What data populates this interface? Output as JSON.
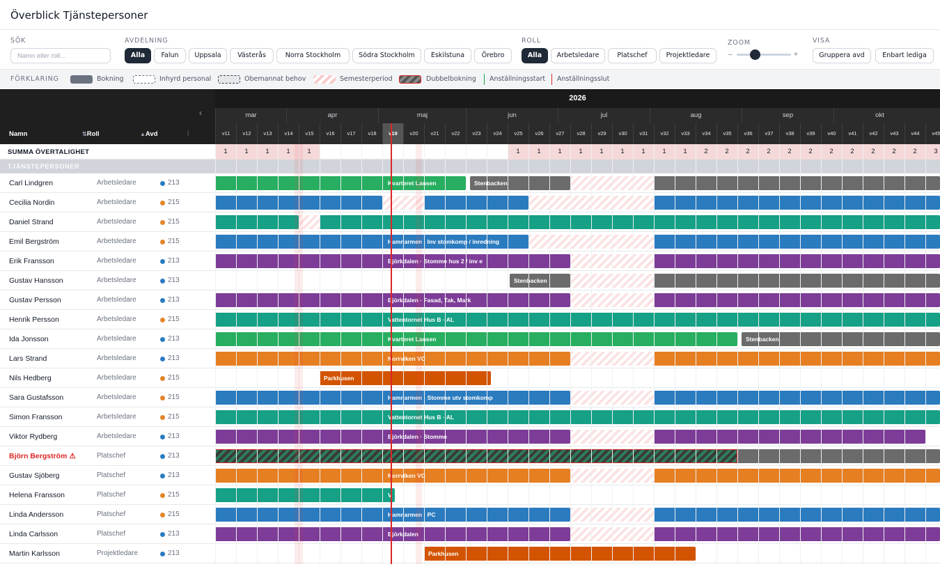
{
  "header": {
    "title": "Överblick Tjänstepersoner"
  },
  "filters": {
    "search_label": "SÖK",
    "search_placeholder": "Namn eller roll...",
    "dept_label": "AVDELNING",
    "departments": [
      "Alla",
      "Falun",
      "Uppsala",
      "Västerås",
      "Norra Stockholm",
      "Södra Stockholm",
      "Eskilstuna",
      "Örebro"
    ],
    "role_label": "ROLL",
    "roles": [
      "Alla",
      "Arbetsledare",
      "Platschef",
      "Projektledare"
    ],
    "zoom_label": "ZOOM",
    "zoom_minus": "–",
    "zoom_plus": "+",
    "view_label": "VISA",
    "views": [
      "Gruppera avd",
      "Enbart lediga"
    ]
  },
  "legend": {
    "label": "FÖRKLARING",
    "items": [
      "Bokning",
      "Inhyrd personal",
      "Obemannat behov",
      "Semesterperiod",
      "Dubbelbokning",
      "Anställningsstart",
      "Anställningsslut"
    ]
  },
  "timeline": {
    "year": "2026",
    "months": [
      "mar",
      "apr",
      "maj",
      "jun",
      "jul",
      "aug",
      "sep",
      "okt"
    ],
    "weeks": [
      "v11",
      "v12",
      "v13",
      "v14",
      "v15",
      "v16",
      "v17",
      "v18",
      "v19",
      "v20",
      "v21",
      "v22",
      "v23",
      "v24",
      "v25",
      "v26",
      "v27",
      "v28",
      "v29",
      "v30",
      "v31",
      "v32",
      "v33",
      "v34",
      "v35",
      "v36",
      "v37",
      "v38",
      "v39",
      "v40",
      "v41",
      "v42",
      "v43",
      "v44",
      "v45"
    ],
    "current_week": "v19"
  },
  "columns": {
    "name": "Namn",
    "role": "Roll",
    "dept": "Avd"
  },
  "summary": {
    "label": "SUMMA ÖVERTALIGHET",
    "values": [
      "1",
      "1",
      "1",
      "1",
      "1",
      "",
      "",
      "",
      "",
      "",
      "",
      "",
      "",
      "",
      "1",
      "1",
      "1",
      "1",
      "1",
      "1",
      "1",
      "1",
      "1",
      "2",
      "2",
      "2",
      "2",
      "2",
      "2",
      "2",
      "2",
      "2",
      "2",
      "2",
      "3"
    ]
  },
  "section": {
    "label": "TJÄNSTEPERSONER"
  },
  "colors": {
    "dept213": "#2b7bbf",
    "dept215": "#e2852b",
    "green": "#27ae60",
    "blue": "#2b7bbf",
    "teal": "#16a085",
    "purple": "#7d3c98",
    "orange": "#e67e22",
    "darkorange": "#d35400",
    "gray": "#6b6b6b"
  },
  "people": [
    {
      "name": "Carl Lindgren",
      "role": "Arbetsledare",
      "dept": "213",
      "bars": [
        {
          "s": 0,
          "e": 12,
          "c": "green",
          "t": "Kvarteret Lansen"
        },
        {
          "s": 12.2,
          "e": 17,
          "c": "gray",
          "t": "Stenbacken"
        },
        {
          "s": 21,
          "e": 35,
          "c": "gray",
          "t": ""
        }
      ],
      "vac": [
        [
          17,
          21
        ]
      ]
    },
    {
      "name": "Cecilia Nordin",
      "role": "Arbetsledare",
      "dept": "215",
      "bars": [
        {
          "s": 0,
          "e": 8,
          "c": "blue",
          "t": ""
        },
        {
          "s": 10,
          "e": 15,
          "c": "blue",
          "t": ""
        },
        {
          "s": 21,
          "e": 35,
          "c": "blue",
          "t": ""
        }
      ],
      "vac": [
        [
          8,
          10
        ],
        [
          15,
          21
        ]
      ]
    },
    {
      "name": "Daniel Strand",
      "role": "Arbetsledare",
      "dept": "215",
      "bars": [
        {
          "s": 0,
          "e": 4,
          "c": "teal",
          "t": ""
        },
        {
          "s": 5,
          "e": 35,
          "c": "teal",
          "t": ""
        }
      ],
      "vac": [
        [
          4,
          5
        ]
      ]
    },
    {
      "name": "Emil Bergström",
      "role": "Arbetsledare",
      "dept": "215",
      "bars": [
        {
          "s": 0,
          "e": 15,
          "c": "blue",
          "t": "Hamnarmen · Inv stomkomp / inredning"
        },
        {
          "s": 21,
          "e": 35,
          "c": "blue",
          "t": ""
        }
      ],
      "vac": [
        [
          15,
          21
        ]
      ]
    },
    {
      "name": "Erik Fransson",
      "role": "Arbetsledare",
      "dept": "213",
      "bars": [
        {
          "s": 0,
          "e": 17,
          "c": "purple",
          "t": "Björkdalen · Stomme hus 2 / inv e"
        },
        {
          "s": 21,
          "e": 35,
          "c": "purple",
          "t": ""
        }
      ],
      "vac": [
        [
          17,
          21
        ]
      ]
    },
    {
      "name": "Gustav Hansson",
      "role": "Arbetsledare",
      "dept": "213",
      "bars": [
        {
          "s": 14.1,
          "e": 17,
          "c": "gray",
          "t": "Stenbacken"
        },
        {
          "s": 21,
          "e": 35,
          "c": "gray",
          "t": ""
        }
      ],
      "vac": [
        [
          17,
          21
        ]
      ]
    },
    {
      "name": "Gustav Persson",
      "role": "Arbetsledare",
      "dept": "213",
      "bars": [
        {
          "s": 0,
          "e": 17,
          "c": "purple",
          "t": "Björkdalen · Fasad, Tak, Mark"
        },
        {
          "s": 21,
          "e": 35,
          "c": "purple",
          "t": ""
        }
      ],
      "vac": [
        [
          17,
          21
        ]
      ]
    },
    {
      "name": "Henrik Persson",
      "role": "Arbetsledare",
      "dept": "215",
      "bars": [
        {
          "s": 0,
          "e": 35,
          "c": "teal",
          "t": "Vattentornet Hus B · AL"
        }
      ],
      "vac": []
    },
    {
      "name": "Ida Jonsson",
      "role": "Arbetsledare",
      "dept": "213",
      "bars": [
        {
          "s": 0,
          "e": 25,
          "c": "green",
          "t": "Kvarteret Lansen"
        },
        {
          "s": 25.2,
          "e": 35,
          "c": "gray",
          "t": "Stenbacken"
        }
      ],
      "vac": []
    },
    {
      "name": "Lars Strand",
      "role": "Arbetsledare",
      "dept": "213",
      "bars": [
        {
          "s": 0,
          "e": 17,
          "c": "orange",
          "t": "Norrviken VC"
        },
        {
          "s": 21,
          "e": 35,
          "c": "orange",
          "t": ""
        }
      ],
      "vac": [
        [
          17,
          21
        ]
      ]
    },
    {
      "name": "Nils Hedberg",
      "role": "Arbetsledare",
      "dept": "215",
      "bars": [
        {
          "s": 5,
          "e": 13.2,
          "c": "darkorange",
          "t": "Parkhusen"
        }
      ],
      "vac": []
    },
    {
      "name": "Sara Gustafsson",
      "role": "Arbetsledare",
      "dept": "215",
      "bars": [
        {
          "s": 0,
          "e": 17,
          "c": "blue",
          "t": "Hamnarmen · Stomme utv stomkomp"
        },
        {
          "s": 21,
          "e": 35,
          "c": "blue",
          "t": ""
        }
      ],
      "vac": [
        [
          17,
          21
        ]
      ]
    },
    {
      "name": "Simon Fransson",
      "role": "Arbetsledare",
      "dept": "215",
      "bars": [
        {
          "s": 0,
          "e": 35,
          "c": "teal",
          "t": "Vattentornet Hus B · AL"
        }
      ],
      "vac": []
    },
    {
      "name": "Viktor Rydberg",
      "role": "Arbetsledare",
      "dept": "213",
      "bars": [
        {
          "s": 0,
          "e": 17,
          "c": "purple",
          "t": "Björkdalen · Stomme"
        },
        {
          "s": 21,
          "e": 34,
          "c": "purple",
          "t": ""
        }
      ],
      "vac": [
        [
          17,
          21
        ]
      ]
    },
    {
      "name": "Björn Bergström",
      "role": "Platschef",
      "dept": "213",
      "warn": true,
      "bars": [
        {
          "s": 25,
          "e": 35,
          "c": "gray",
          "t": ""
        }
      ],
      "dbl": [
        0,
        25
      ],
      "vac": []
    },
    {
      "name": "Gustav Sjöberg",
      "role": "Platschef",
      "dept": "213",
      "bars": [
        {
          "s": 0,
          "e": 17,
          "c": "orange",
          "t": "Norrviken VC"
        },
        {
          "s": 21,
          "e": 35,
          "c": "orange",
          "t": ""
        }
      ],
      "vac": [
        [
          17,
          21
        ]
      ]
    },
    {
      "name": "Helena Fransson",
      "role": "Platschef",
      "dept": "215",
      "bars": [
        {
          "s": 0,
          "e": 8.6,
          "c": "teal",
          "t": "V"
        }
      ],
      "vac": []
    },
    {
      "name": "Linda Andersson",
      "role": "Platschef",
      "dept": "215",
      "bars": [
        {
          "s": 0,
          "e": 17,
          "c": "blue",
          "t": "Hamnarmen · PC"
        },
        {
          "s": 21,
          "e": 35,
          "c": "blue",
          "t": ""
        }
      ],
      "vac": [
        [
          17,
          21
        ]
      ]
    },
    {
      "name": "Linda Carlsson",
      "role": "Platschef",
      "dept": "213",
      "bars": [
        {
          "s": 0,
          "e": 17,
          "c": "purple",
          "t": "Björkdalen"
        },
        {
          "s": 21,
          "e": 35,
          "c": "purple",
          "t": ""
        }
      ],
      "vac": [
        [
          17,
          21
        ]
      ]
    },
    {
      "name": "Martin Karlsson",
      "role": "Projektledare",
      "dept": "213",
      "bars": [
        {
          "s": 10,
          "e": 23,
          "c": "darkorange",
          "t": "Parkhusen"
        }
      ],
      "vac": []
    }
  ]
}
